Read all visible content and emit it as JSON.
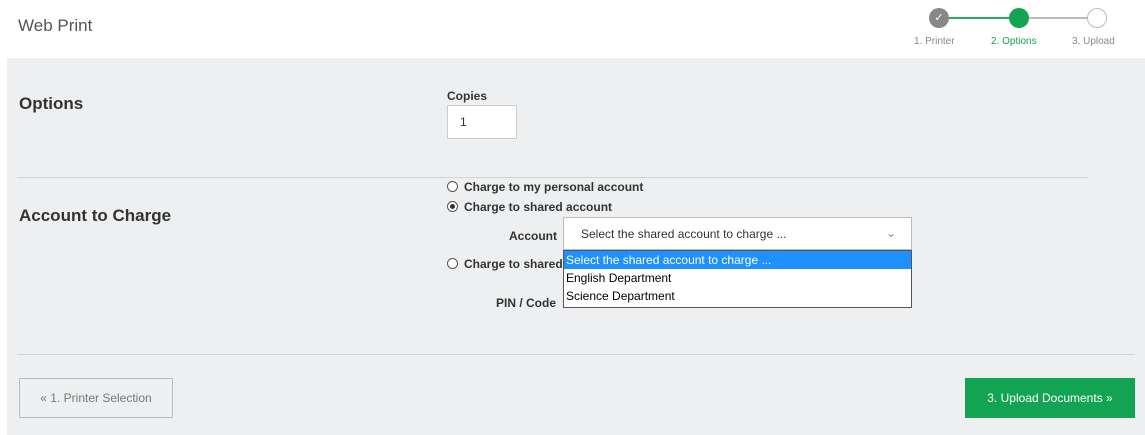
{
  "header": {
    "title": "Web Print"
  },
  "stepper": {
    "steps": [
      {
        "label": "1. Printer",
        "state": "done"
      },
      {
        "label": "2. Options",
        "state": "active"
      },
      {
        "label": "3. Upload",
        "state": "todo"
      }
    ],
    "checkmark": "✓"
  },
  "options": {
    "title": "Options",
    "copies_label": "Copies",
    "copies_value": "1"
  },
  "account": {
    "title": "Account to Charge",
    "radios": [
      {
        "label": "Charge to my personal account",
        "checked": false
      },
      {
        "label": "Charge to shared account",
        "checked": true
      },
      {
        "label": "Charge to shared",
        "checked": false
      }
    ],
    "account_label": "Account",
    "select_value": "Select the shared account to charge ...",
    "pin_label": "PIN / Code",
    "dropdown_options": [
      {
        "label": "Select the shared account to charge ...",
        "selected": true
      },
      {
        "label": "English Department",
        "selected": false
      },
      {
        "label": "Science Department",
        "selected": false
      }
    ]
  },
  "footer": {
    "prev_label": "« 1. Printer Selection",
    "next_label": "3. Upload Documents »"
  },
  "colors": {
    "accent": "#12a452",
    "panel_bg": "#eeeff0",
    "dropdown_highlight": "#1e90ff"
  }
}
